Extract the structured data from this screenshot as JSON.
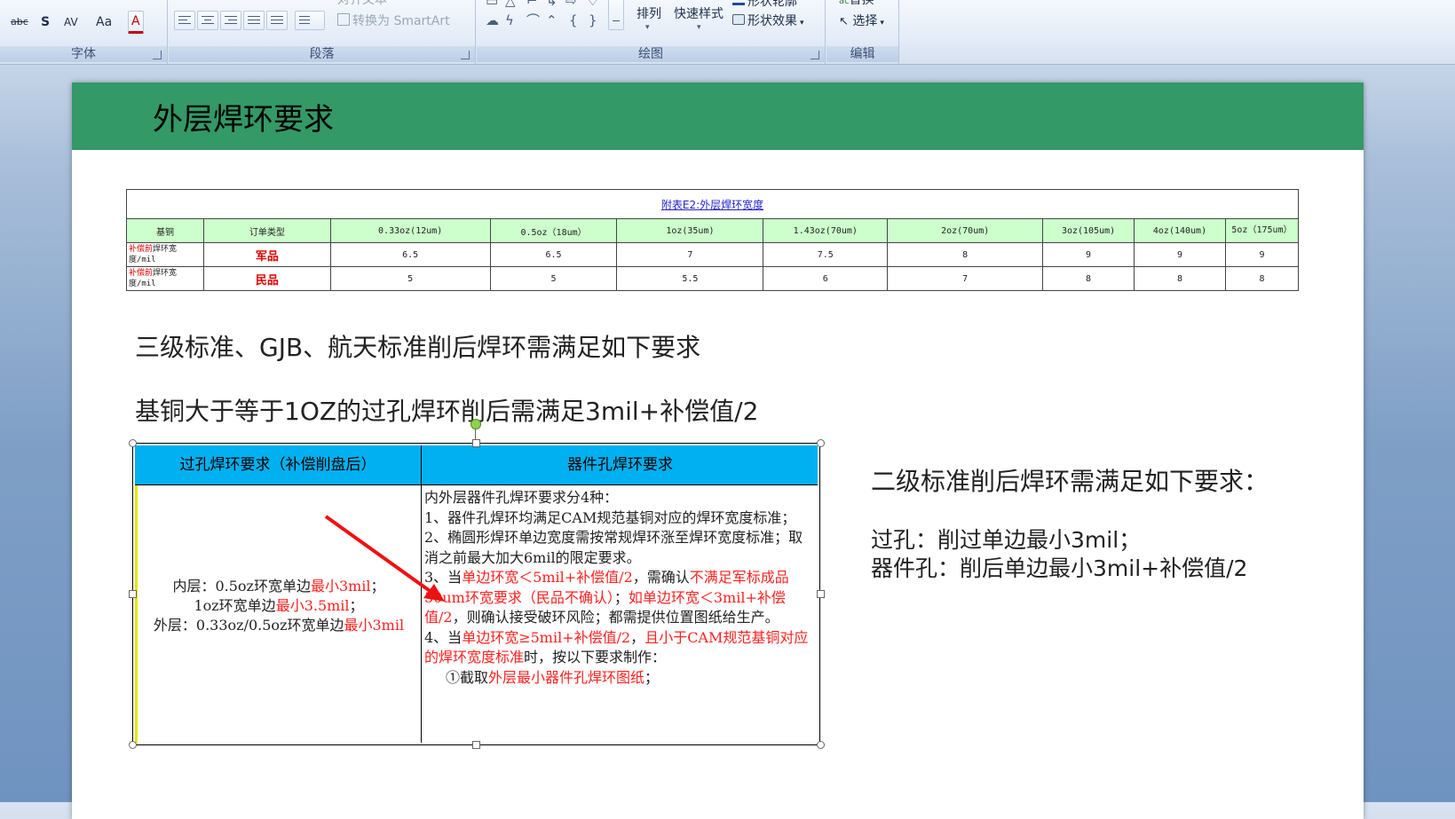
{
  "ribbon": {
    "font_group": {
      "label": "字体",
      "strike_label": "abc",
      "shadow_label": "S",
      "spacing_label": "AV",
      "case_label": "Aa",
      "color_label": "A"
    },
    "paragraph_group": {
      "label": "段落",
      "align_text_label": "对齐文本",
      "smartart_label": "转换为 SmartArt"
    },
    "drawing_group": {
      "label": "绘图",
      "arrange_label": "排列",
      "quick_styles_label": "快速样式",
      "shape_outline_label": "形状轮廓",
      "shape_effects_label": "形状效果"
    },
    "editing_group": {
      "label": "编辑",
      "replace_label": "替换",
      "select_label": "选择"
    }
  },
  "slide": {
    "title": "外层焊环要求",
    "ring_table": {
      "caption": "附表E2:外层焊环宽度",
      "headers": [
        "基铜",
        "订单类型",
        "0.33oz(12um)",
        "0.5oz（18um）",
        "1oz(35um)",
        "1.43oz(70um)",
        "2oz(70um)",
        "3oz(105um)",
        "4oz(140um)",
        "5oz（175um）"
      ],
      "rows": [
        {
          "label_red": "补偿前",
          "label_rest": "焊环宽度/mil",
          "type": "军品",
          "values": [
            "6.5",
            "6.5",
            "7",
            "7.5",
            "8",
            "9",
            "9",
            "9"
          ]
        },
        {
          "label_red": "补偿前",
          "label_rest": "焊环宽度/mil",
          "type": "民品",
          "values": [
            "5",
            "5",
            "5.5",
            "6",
            "7",
            "8",
            "8",
            "8"
          ]
        }
      ]
    },
    "text_line1": "三级标准、GJB、航天标准削后焊环需满足如下要求",
    "text_line2": "基铜大于等于1OZ的过孔焊环削后需满足3mil+补偿值/2",
    "pic_table": {
      "header_left": "过孔焊环要求（补偿削盘后）",
      "header_right": "器件孔焊环要求",
      "left": {
        "l1a": "内层：0.5oz环宽单边",
        "l1b": "最小3mil",
        "l1c": "；",
        "l2a": "1oz环宽单边",
        "l2b": "最小3.5mil",
        "l2c": "；",
        "l3a": "外层：0.33oz/0.5oz环宽单边",
        "l3b": "最小3mil"
      },
      "right": {
        "r0": "内外层器件孔焊环要求分4种：",
        "r1": "1、器件孔焊环均满足CAM规范基铜对应的焊环宽度标准；",
        "r2": "2、椭圆形焊环单边宽度需按常规焊环涨至焊环宽度标准；取消之前最大加大6mil的限定要求。",
        "r3a": "3、当",
        "r3b": "单边环宽＜5mil+补偿值/2",
        "r3c": "，需确认",
        "r3d": "不满足军标成品50um环宽要求（民品不确认）",
        "r3e": "；",
        "r3f": "如单边环宽＜3mil+补偿值/2",
        "r3g": "，则确认接受破环风险；都需提供位置图纸给生产。",
        "r4a": "4、当",
        "r4b": "单边环宽≥5mil+补偿值/2",
        "r4c": "，",
        "r4d": "且小于CAM规范基铜对应的焊环宽度标准",
        "r4e": "时，按以下要求制作：",
        "r5a": "①截取",
        "r5b": "外层最小器件孔焊环图纸",
        "r5c": "；"
      }
    },
    "right_heading": "二级标准削后焊环需满足如下要求：",
    "right_line1": "过孔：削过单边最小3mil；",
    "right_line2": "器件孔：削后单边最小3mil+补偿值/2"
  }
}
